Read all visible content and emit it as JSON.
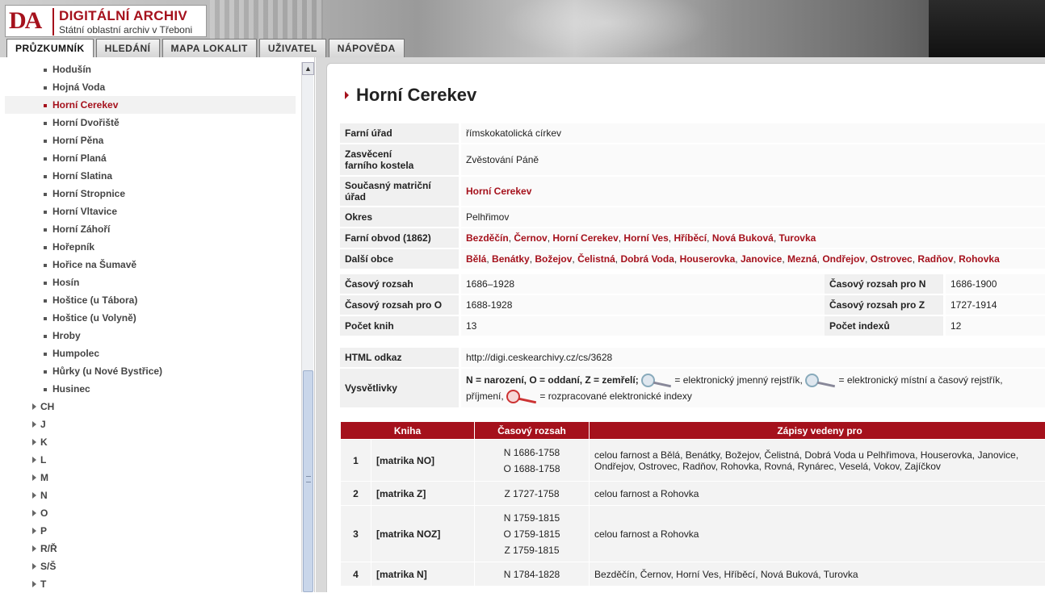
{
  "header": {
    "logo_mark": "DA",
    "logo_title": "DIGITÁLNÍ ARCHIV",
    "logo_subtitle": "Státní oblastní archiv v Třeboni"
  },
  "tabs": [
    {
      "label": "PRŮZKUMNÍK"
    },
    {
      "label": "HLEDÁNÍ"
    },
    {
      "label": "MAPA LOKALIT"
    },
    {
      "label": "UŽIVATEL"
    },
    {
      "label": "NÁPOVĚDA"
    }
  ],
  "sidebar": {
    "leaves": [
      "Hodušín",
      "Hojná Voda",
      "Horní Cerekev",
      "Horní Dvořiště",
      "Horní Pěna",
      "Horní Planá",
      "Horní Slatina",
      "Horní Stropnice",
      "Horní Vltavice",
      "Horní Záhoří",
      "Hořepník",
      "Hořice na Šumavě",
      "Hosín",
      "Hoštice (u Tábora)",
      "Hoštice (u Volyně)",
      "Hroby",
      "Humpolec",
      "Hůrky (u Nové Bystřice)",
      "Husinec"
    ],
    "selected": "Horní Cerekev",
    "groups": [
      "CH",
      "J",
      "K",
      "L",
      "M",
      "N",
      "O",
      "P",
      "R/Ř",
      "S/Š",
      "T"
    ]
  },
  "main": {
    "title": "Horní Cerekev",
    "farni_urad": {
      "label": "Farní úřad",
      "value": "římskokatolická církev"
    },
    "zasveceni": {
      "label1": "Zasvěcení",
      "label2": "farního kostela",
      "value": "Zvěstování Páně"
    },
    "soucasny": {
      "label": "Současný matriční úřad",
      "value": "Horní Cerekev"
    },
    "okres": {
      "label": "Okres",
      "value": "Pelhřimov"
    },
    "farni_obvod": {
      "label": "Farní obvod (1862)",
      "links": [
        "Bezděčín",
        "Černov",
        "Horní Cerekev",
        "Horní Ves",
        "Hříběcí",
        "Nová Buková",
        "Turovka"
      ]
    },
    "dalsi_obce": {
      "label": "Další obce",
      "links": [
        "Bělá",
        "Benátky",
        "Božejov",
        "Čelistná",
        "Dobrá Voda",
        "Houserovka",
        "Janovice",
        "Mezná",
        "Ondřejov",
        "Ostrovec",
        "Radňov",
        "Rohovka"
      ]
    },
    "rozsah": {
      "label": "Časový rozsah",
      "value": "1686–1928",
      "n_label": "Časový rozsah pro N",
      "n_value": "1686-1900",
      "o_label": "Časový rozsah pro O",
      "o_value": "1688-1928",
      "z_label": "Časový rozsah pro Z",
      "z_value": "1727-1914",
      "knih_label": "Počet knih",
      "knih_value": "13",
      "idx_label": "Počet indexů",
      "idx_value": "12"
    },
    "odkaz": {
      "label": "HTML odkaz",
      "value": "http://digi.ceskearchivy.cz/cs/3628"
    },
    "vysvetlivky": {
      "label": "Vysvětlivky",
      "t1": "N = narození, O = oddaní, Z = zemřelí;",
      "t2": "= elektronický jmenný rejstřík,",
      "t3": "= elektronický místní a časový rejstřík,",
      "t4": "příjmení,",
      "t5": "= rozpracované elektronické indexy"
    },
    "books": {
      "headers": [
        "Kniha",
        "Časový rozsah",
        "Zápisy vedeny pro"
      ],
      "rows": [
        {
          "num": "1",
          "name": "[matrika NO]",
          "ranges": [
            "N 1686-1758",
            "O 1688-1758"
          ],
          "desc": "celou farnost a Bělá, Benátky, Božejov, Čelistná, Dobrá Voda u Pelhřimova, Houserovka, Janovice, Ondřejov, Ostrovec, Radňov, Rohovka, Rovná, Rynárec, Veselá, Vokov, Zajíčkov"
        },
        {
          "num": "2",
          "name": "[matrika Z]",
          "ranges": [
            "Z 1727-1758"
          ],
          "desc": "celou farnost a Rohovka"
        },
        {
          "num": "3",
          "name": "[matrika NOZ]",
          "ranges": [
            "N 1759-1815",
            "O 1759-1815",
            "Z 1759-1815"
          ],
          "desc": "celou farnost a Rohovka"
        },
        {
          "num": "4",
          "name": "[matrika N]",
          "ranges": [
            "N 1784-1828"
          ],
          "desc": "Bezděčín, Černov, Horní Ves, Hříběcí, Nová Buková, Turovka"
        }
      ]
    }
  },
  "colors": {
    "accent": "#a5111c"
  }
}
